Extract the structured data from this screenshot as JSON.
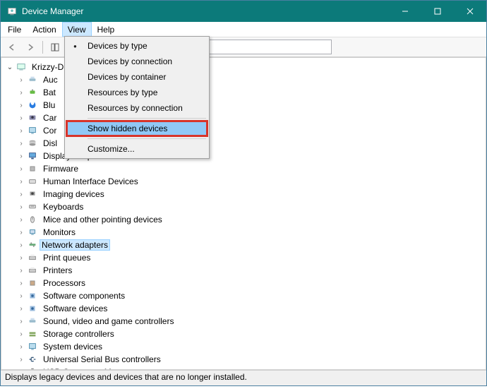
{
  "window": {
    "title": "Device Manager"
  },
  "menubar": {
    "file": "File",
    "action": "Action",
    "view": "View",
    "help": "Help"
  },
  "dropdown": {
    "items": [
      "Devices by type",
      "Devices by connection",
      "Devices by container",
      "Resources by type",
      "Resources by connection"
    ],
    "show_hidden": "Show hidden devices",
    "customize": "Customize..."
  },
  "tree": {
    "root": "Krizzy-D",
    "nodes": [
      {
        "label": "Audio inputs and outputs",
        "truncated": "Auc"
      },
      {
        "label": "Batteries",
        "truncated": "Bat"
      },
      {
        "label": "Bluetooth",
        "truncated": "Blu"
      },
      {
        "label": "Cameras",
        "truncated": "Car"
      },
      {
        "label": "Computer",
        "truncated": "Cor"
      },
      {
        "label": "Disk drives",
        "truncated": "Disl"
      },
      {
        "label": "Display adapters",
        "truncated": "Display adapters"
      },
      {
        "label": "Firmware",
        "truncated": "Firmware"
      },
      {
        "label": "Human Interface Devices",
        "truncated": "Human Interface Devices"
      },
      {
        "label": "Imaging devices",
        "truncated": "Imaging devices"
      },
      {
        "label": "Keyboards",
        "truncated": "Keyboards"
      },
      {
        "label": "Mice and other pointing devices",
        "truncated": "Mice and other pointing devices"
      },
      {
        "label": "Monitors",
        "truncated": "Monitors"
      },
      {
        "label": "Network adapters",
        "truncated": "Network adapters",
        "selected": true
      },
      {
        "label": "Print queues",
        "truncated": "Print queues"
      },
      {
        "label": "Printers",
        "truncated": "Printers"
      },
      {
        "label": "Processors",
        "truncated": "Processors"
      },
      {
        "label": "Software components",
        "truncated": "Software components"
      },
      {
        "label": "Software devices",
        "truncated": "Software devices"
      },
      {
        "label": "Sound, video and game controllers",
        "truncated": "Sound, video and game controllers"
      },
      {
        "label": "Storage controllers",
        "truncated": "Storage controllers"
      },
      {
        "label": "System devices",
        "truncated": "System devices"
      },
      {
        "label": "Universal Serial Bus controllers",
        "truncated": "Universal Serial Bus controllers"
      },
      {
        "label": "USB Connector Managers",
        "truncated": "USB Connector Managers"
      }
    ]
  },
  "statusbar": {
    "text": "Displays legacy devices and devices that are no longer installed."
  }
}
